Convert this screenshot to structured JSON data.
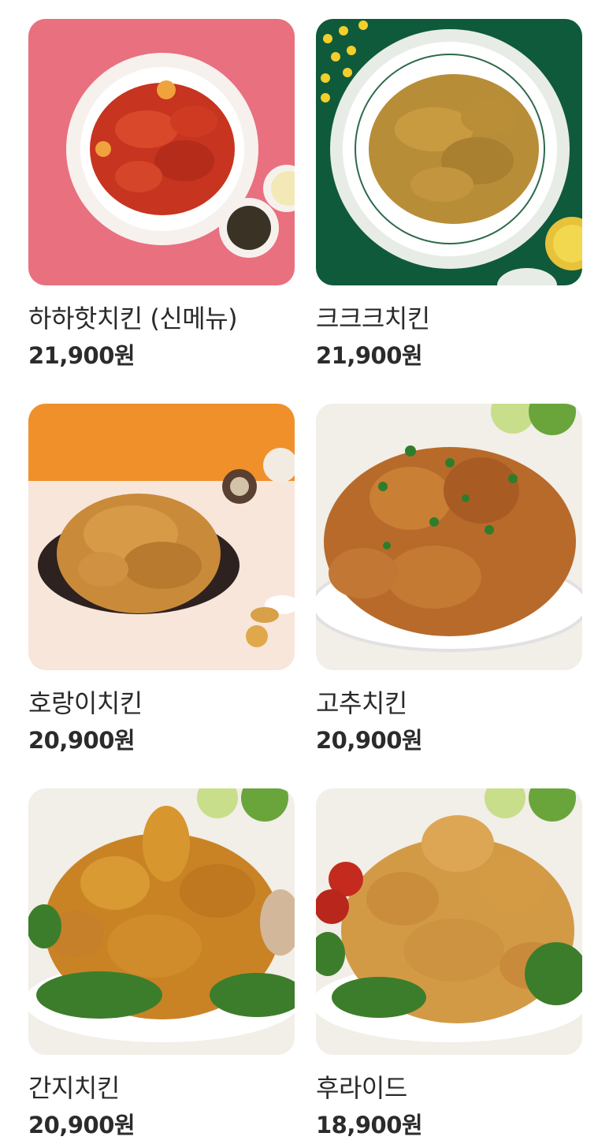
{
  "menu": {
    "items": [
      {
        "name": "하하핫치킨 (신메뉴)",
        "price": "21,900원",
        "image": "spicy-red-chicken-plate-image",
        "bg": "#e9707f"
      },
      {
        "name": "크크크치킨",
        "price": "21,900원",
        "image": "seasoned-crispy-chicken-plate-image",
        "bg": "#0f5a3a"
      },
      {
        "name": "호랑이치킨",
        "price": "20,900원",
        "image": "garlic-crunch-chicken-plate-image",
        "bg": "#f0902a"
      },
      {
        "name": "고추치킨",
        "price": "20,900원",
        "image": "pepper-chicken-plate-image",
        "bg": "#f2eee8"
      },
      {
        "name": "간지치킨",
        "price": "20,900원",
        "image": "glazed-chicken-plate-image",
        "bg": "#f2eee8"
      },
      {
        "name": "후라이드",
        "price": "18,900원",
        "image": "fried-chicken-plate-image",
        "bg": "#f2eee8"
      }
    ]
  }
}
